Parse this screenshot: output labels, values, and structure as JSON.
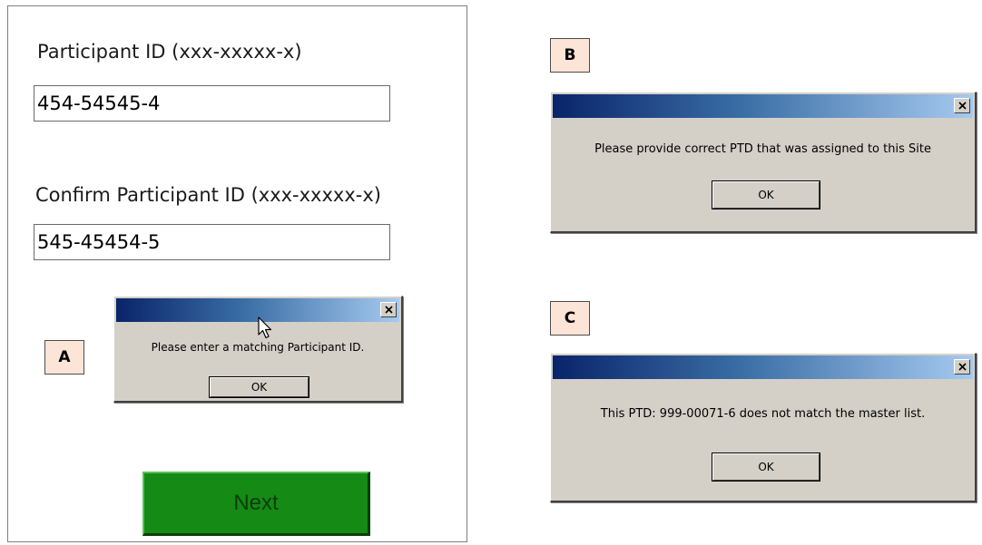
{
  "form": {
    "participant_id_label": "Participant ID (xxx-xxxxx-x)",
    "participant_id_value": "454-54545-4",
    "confirm_id_label": "Confirm Participant ID (xxx-xxxxx-x)",
    "confirm_id_value": "545-45454-5",
    "next_label": "Next"
  },
  "tags": {
    "a": "A",
    "b": "B",
    "c": "C"
  },
  "dialogs": {
    "a": {
      "message": "Please enter a matching Participant ID.",
      "ok_label": "OK"
    },
    "b": {
      "message": "Please provide correct PTD that was assigned to this Site",
      "ok_label": "OK"
    },
    "c": {
      "message": "This PTD: 999-00071-6 does not match the master list.",
      "ok_label": "OK"
    }
  },
  "colors": {
    "next_button": "#158a15",
    "tag_fill": "#fce4d6",
    "dialog_face": "#d4d0c8",
    "titlebar_start": "#0a246a",
    "titlebar_end": "#a6caf0"
  },
  "icons": {
    "close": "close-icon",
    "cursor": "mouse-pointer-icon"
  }
}
